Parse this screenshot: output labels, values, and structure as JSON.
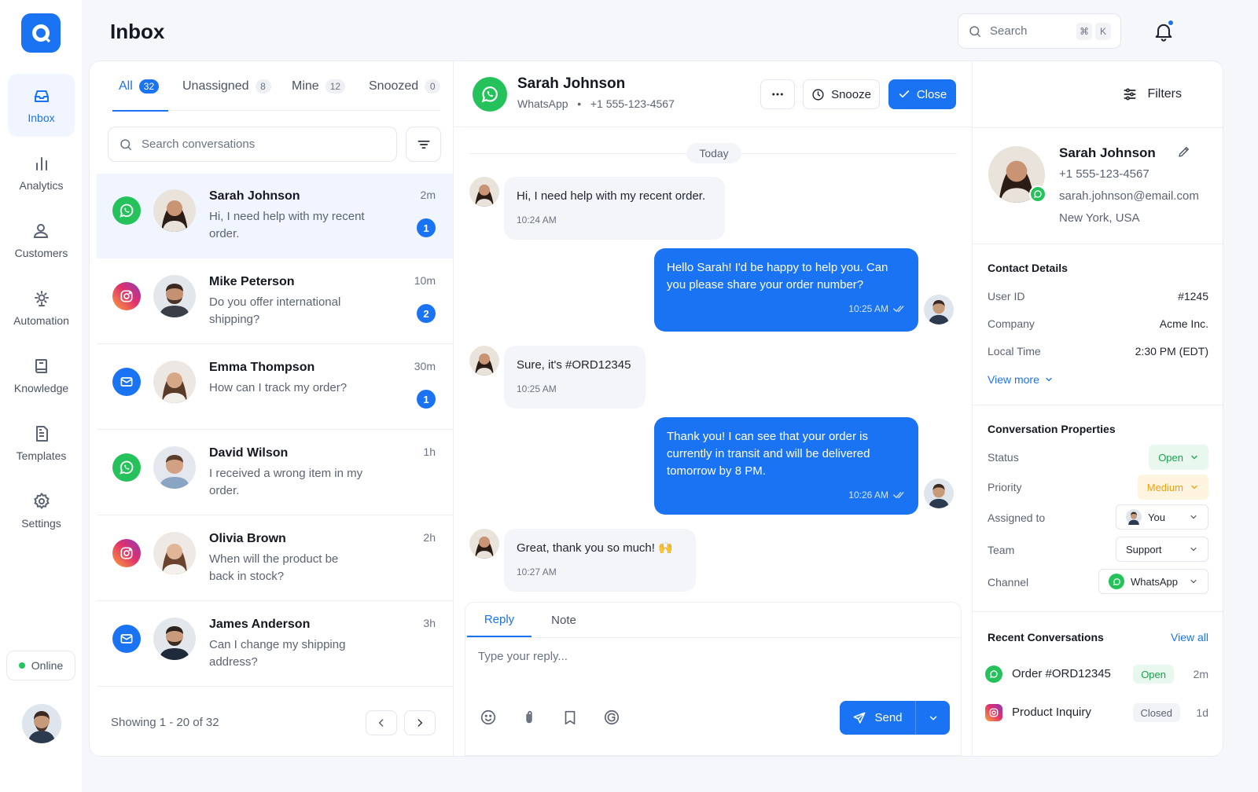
{
  "colors": {
    "accent": "#1a73f2",
    "whatsapp": "#25c25c",
    "online": "#22c55e",
    "open_bg": "#e8f8ee",
    "open_fg": "#16a34a",
    "medium_bg": "#fff4e0",
    "medium_fg": "#f59e0b"
  },
  "nav": {
    "items": [
      {
        "label": "Inbox",
        "icon": "inbox-icon"
      },
      {
        "label": "Analytics",
        "icon": "bar-chart-icon"
      },
      {
        "label": "Customers",
        "icon": "users-icon"
      },
      {
        "label": "Automation",
        "icon": "automation-icon"
      },
      {
        "label": "Knowledge",
        "icon": "book-icon"
      },
      {
        "label": "Templates",
        "icon": "document-icon"
      },
      {
        "label": "Settings",
        "icon": "gear-icon"
      }
    ],
    "status": "Online"
  },
  "header": {
    "title": "Inbox",
    "search_placeholder": "Search",
    "shortcut": [
      "⌘",
      "K"
    ]
  },
  "list": {
    "tabs": [
      {
        "label": "All",
        "count": "32"
      },
      {
        "label": "Unassigned",
        "count": "8"
      },
      {
        "label": "Mine",
        "count": "12"
      },
      {
        "label": "Snoozed",
        "count": "0"
      }
    ],
    "search_placeholder": "Search conversations",
    "conversations": [
      {
        "channel": "whatsapp",
        "name": "Sarah Johnson",
        "preview": "Hi, I need help with my recent order.",
        "time": "2m",
        "unread": "1"
      },
      {
        "channel": "instagram",
        "name": "Mike Peterson",
        "preview": "Do you offer international shipping?",
        "time": "10m",
        "unread": "2"
      },
      {
        "channel": "email",
        "name": "Emma Thompson",
        "preview": "How can I track my order?",
        "time": "30m",
        "unread": "1"
      },
      {
        "channel": "whatsapp",
        "name": "David Wilson",
        "preview": "I received a wrong item in my order.",
        "time": "1h",
        "unread": ""
      },
      {
        "channel": "instagram",
        "name": "Olivia Brown",
        "preview": "When will the product be back in stock?",
        "time": "2h",
        "unread": ""
      },
      {
        "channel": "email",
        "name": "James Anderson",
        "preview": "Can I change my shipping address?",
        "time": "3h",
        "unread": ""
      }
    ],
    "footer": "Showing 1 - 20 of 32"
  },
  "chat": {
    "name": "Sarah Johnson",
    "channel": "WhatsApp",
    "phone": "+1 555-123-4567",
    "snooze_label": "Snooze",
    "close_label": "Close",
    "day": "Today",
    "messages": [
      {
        "dir": "in",
        "text": "Hi, I need help with my recent order.",
        "time": "10:24 AM"
      },
      {
        "dir": "out",
        "text": "Hello Sarah! I'd be happy to help you. Can you please share your order number?",
        "time": "10:25 AM"
      },
      {
        "dir": "in",
        "text": "Sure, it's #ORD12345",
        "time": "10:25 AM"
      },
      {
        "dir": "out",
        "text": "Thank you! I can see that your order is currently in transit and will be delivered tomorrow by 8 PM.",
        "time": "10:26 AM"
      },
      {
        "dir": "in",
        "text": "Great, thank you so much! 🙌",
        "time": "10:27 AM"
      }
    ],
    "composer": {
      "tab_reply": "Reply",
      "tab_note": "Note",
      "placeholder": "Type your reply...",
      "send_label": "Send"
    }
  },
  "side": {
    "filters_label": "Filters",
    "profile": {
      "name": "Sarah Johnson",
      "phone": "+1 555-123-4567",
      "email": "sarah.johnson@email.com",
      "location": "New York, USA"
    },
    "contact": {
      "title": "Contact Details",
      "rows": [
        {
          "k": "User ID",
          "v": "#1245"
        },
        {
          "k": "Company",
          "v": "Acme Inc."
        },
        {
          "k": "Local Time",
          "v": "2:30 PM (EDT)"
        }
      ],
      "view_more": "View more"
    },
    "properties": {
      "title": "Conversation Properties",
      "status_label": "Status",
      "status": "Open",
      "priority_label": "Priority",
      "priority": "Medium",
      "assigned_label": "Assigned to",
      "assigned": "You",
      "team_label": "Team",
      "team": "Support",
      "channel_label": "Channel",
      "channel": "WhatsApp"
    },
    "recent": {
      "title": "Recent Conversations",
      "view_all": "View all",
      "items": [
        {
          "channel": "whatsapp",
          "name": "Order #ORD12345",
          "status": "Open",
          "time": "2m"
        },
        {
          "channel": "instagram",
          "name": "Product Inquiry",
          "status": "Closed",
          "time": "1d"
        }
      ]
    }
  }
}
